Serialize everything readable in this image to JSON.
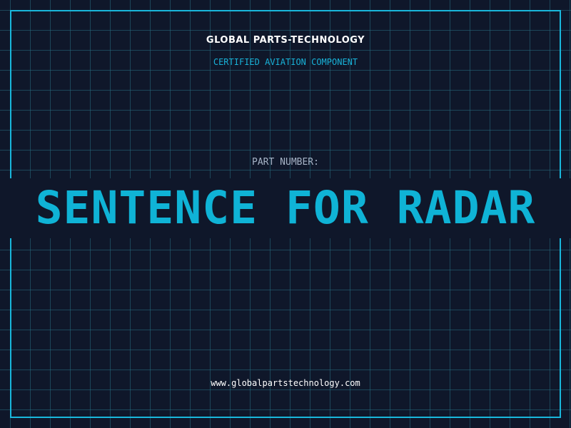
{
  "header": {
    "brand": "GLOBAL PARTS-TECHNOLOGY",
    "subtitle": "CERTIFIED AVIATION COMPONENT"
  },
  "part": {
    "label": "PART NUMBER:",
    "number": "SENTENCE FOR RADAR"
  },
  "footer": {
    "url": "www.globalpartstechnology.com"
  },
  "colors": {
    "background": "#0f172a",
    "accent": "#19b7dc",
    "grid": "#266e80",
    "text": "#ffffff",
    "label": "#a6b3c6"
  }
}
